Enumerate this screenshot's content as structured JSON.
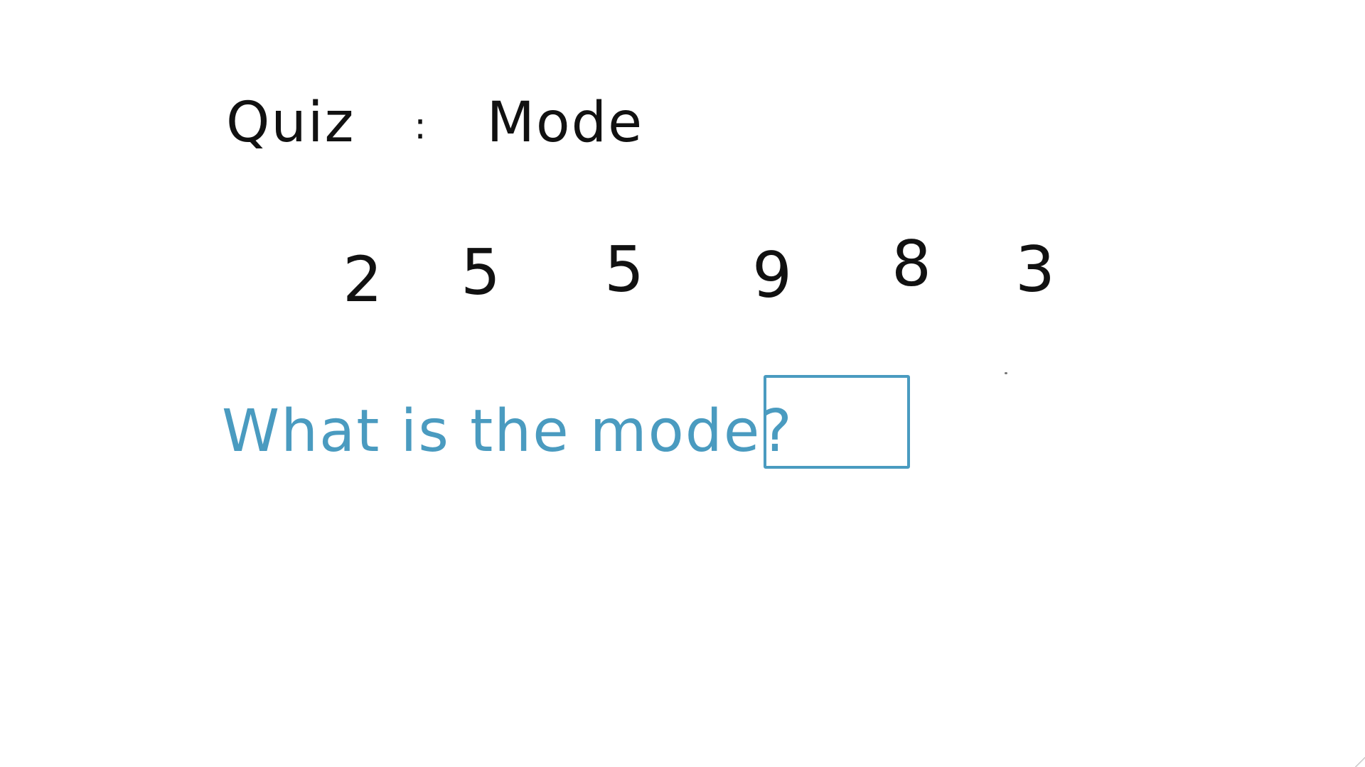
{
  "quiz": {
    "label": "Quiz",
    "separator": ":",
    "topic": "Mode"
  },
  "numbers": [
    "2",
    "5",
    "5",
    "9",
    "8",
    "3"
  ],
  "question": {
    "text": "What is the mode?",
    "answer_value": ""
  },
  "colors": {
    "text": "#111111",
    "accent": "#4a9bc0",
    "background": "#ffffff"
  }
}
